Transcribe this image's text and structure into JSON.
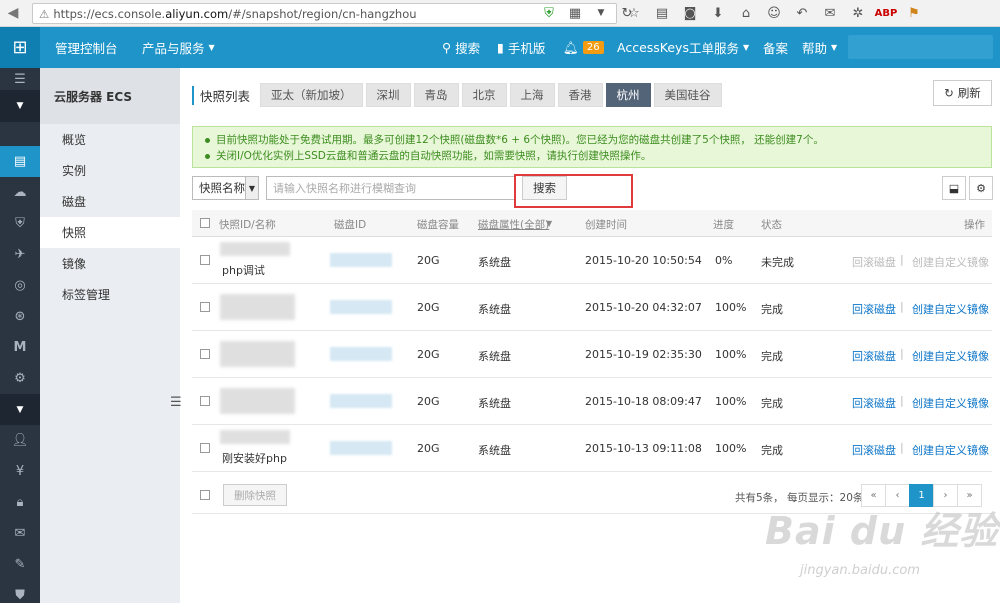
{
  "browser": {
    "url_prefix": "https://ecs.console.",
    "url_host": "aliyun.com",
    "url_suffix": "/#/snapshot/region/cn-hangzhou"
  },
  "topnav": {
    "home": "管理控制台",
    "products": "产品与服务",
    "search": "搜索",
    "mobile": "手机版",
    "notify_count": "26",
    "accesskeys": "AccessKeys",
    "tickets": "工单服务",
    "beian": "备案",
    "help": "帮助"
  },
  "submenu": {
    "title": "云服务器 ECS",
    "items": [
      "概览",
      "实例",
      "磁盘",
      "快照",
      "镜像",
      "标签管理"
    ]
  },
  "page": {
    "title": "快照列表",
    "regions": [
      "亚太（新加坡）",
      "深圳",
      "青岛",
      "北京",
      "上海",
      "香港",
      "杭州",
      "美国硅谷"
    ],
    "active_region": "杭州",
    "refresh": "刷新"
  },
  "notice": {
    "line1": "目前快照功能处于免费试用期。最多可创建12个快照(磁盘数*6 + 6个快照)。您已经为您的磁盘共创建了5个快照， 还能创建7个。",
    "line2": "关闭I/O优化实例上SSD云盘和普通云盘的自动快照功能，如需要快照，请执行创建快照操作。"
  },
  "search": {
    "select": "快照名称",
    "placeholder": "请输入快照名称进行模糊查询",
    "button": "搜索"
  },
  "table": {
    "headers": {
      "id_name": "快照ID/名称",
      "disk_id": "磁盘ID",
      "capacity": "磁盘容量",
      "attr": "磁盘属性(全部)",
      "created": "创建时间",
      "progress": "进度",
      "status": "状态",
      "ops": "操作"
    },
    "rows": [
      {
        "name": "php调试",
        "capacity": "20G",
        "attr": "系统盘",
        "created": "2015-10-20 10:50:54",
        "progress": "0%",
        "status": "未完成",
        "op1": "回滚磁盘",
        "op2": "创建自定义镜像"
      },
      {
        "name": "",
        "capacity": "20G",
        "attr": "系统盘",
        "created": "2015-10-20 04:32:07",
        "progress": "100%",
        "status": "完成",
        "op1": "回滚磁盘",
        "op2": "创建自定义镜像"
      },
      {
        "name": "",
        "capacity": "20G",
        "attr": "系统盘",
        "created": "2015-10-19 02:35:30",
        "progress": "100%",
        "status": "完成",
        "op1": "回滚磁盘",
        "op2": "创建自定义镜像"
      },
      {
        "name": "",
        "capacity": "20G",
        "attr": "系统盘",
        "created": "2015-10-18 08:09:47",
        "progress": "100%",
        "status": "完成",
        "op1": "回滚磁盘",
        "op2": "创建自定义镜像"
      },
      {
        "name": "刚安装好php",
        "capacity": "20G",
        "attr": "系统盘",
        "created": "2015-10-13 09:11:08",
        "progress": "100%",
        "status": "完成",
        "op1": "回滚磁盘",
        "op2": "创建自定义镜像"
      }
    ]
  },
  "footer": {
    "delete": "删除快照",
    "pageinfo": "共有5条， 每页显示：20条",
    "pages": [
      "«",
      "‹",
      "1",
      "›",
      "»"
    ]
  },
  "watermark": {
    "text": "Bai du 经验",
    "sub": "jingyan.baidu.com"
  }
}
